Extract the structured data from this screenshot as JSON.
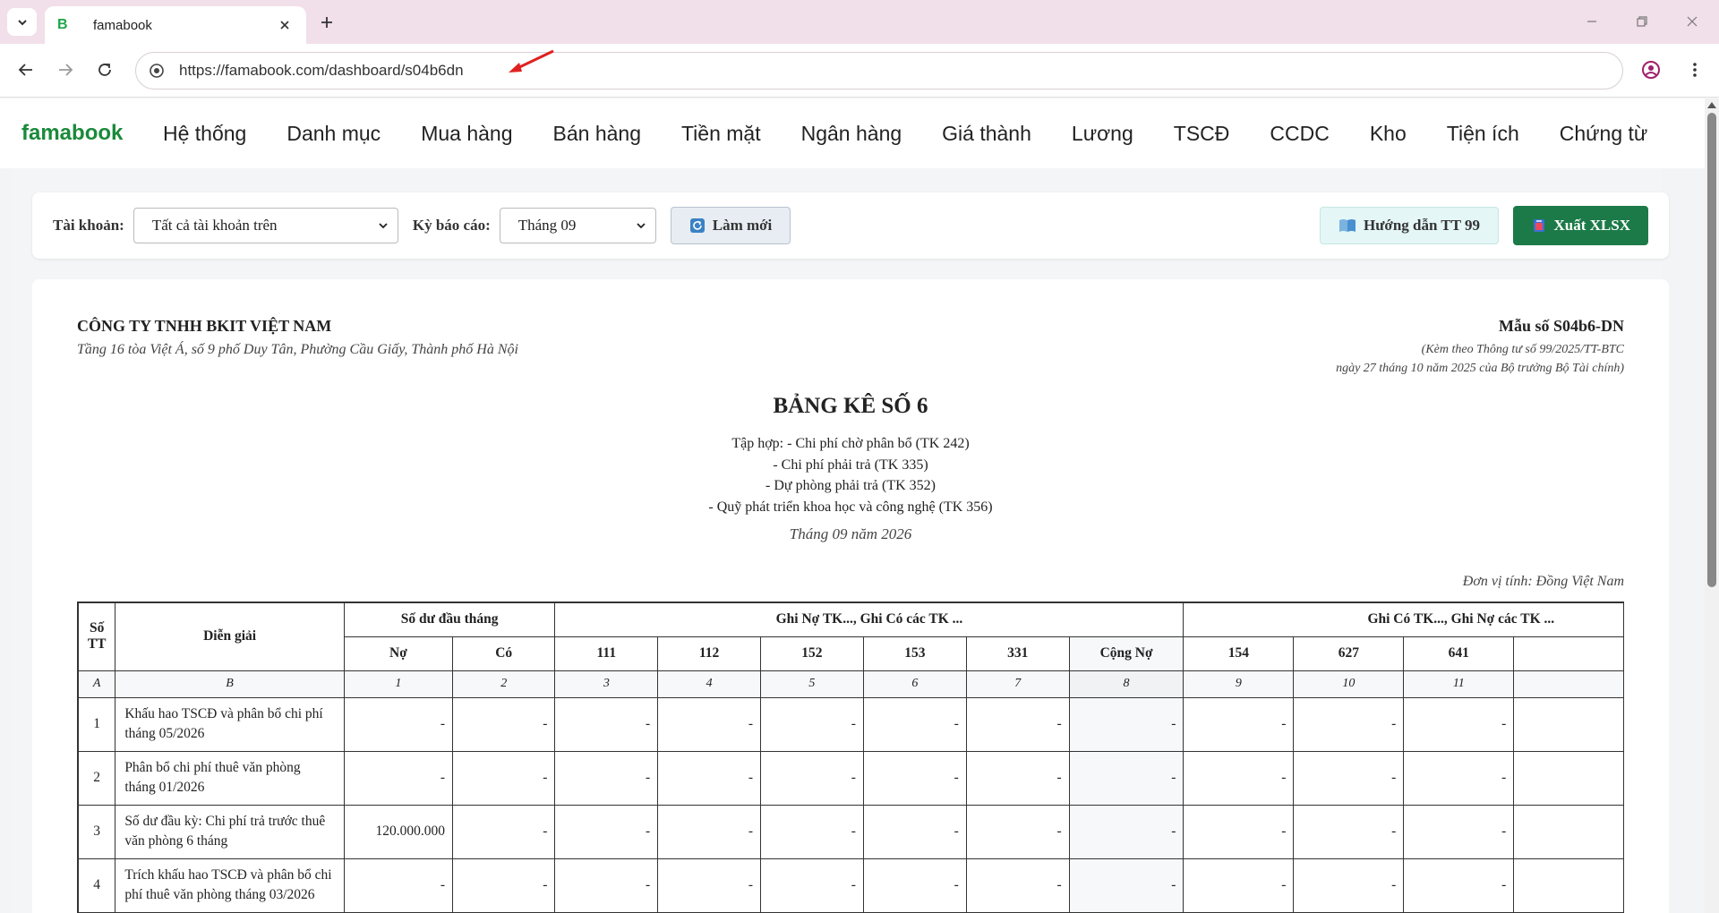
{
  "browser": {
    "tab_favicon": "B",
    "tab_title": "famabook",
    "url": "https://famabook.com/dashboard/s04b6dn"
  },
  "app": {
    "brand": "famabook",
    "menu": [
      "Hệ thống",
      "Danh mục",
      "Mua hàng",
      "Bán hàng",
      "Tiền mặt",
      "Ngân hàng",
      "Giá thành",
      "Lương",
      "TSCĐ",
      "CCDC",
      "Kho",
      "Tiện ích",
      "Chứng từ"
    ]
  },
  "filters": {
    "account_label": "Tài khoản:",
    "account_value": "Tất cả tài khoản trên",
    "period_label": "Kỳ báo cáo:",
    "period_value": "Tháng 09",
    "refresh_label": "Làm mới",
    "guide_label": "Hướng dẫn TT 99",
    "export_label": "Xuất XLSX"
  },
  "report": {
    "company": "CÔNG TY TNHH BKIT VIỆT NAM",
    "address": "Tầng 16 tòa Việt Á, số 9 phố Duy Tân, Phường Cầu Giấy, Thành phố Hà Nội",
    "form_code": "Mẫu số S04b6-DN",
    "form_note_1": "(Kèm theo Thông tư số 99/2025/TT-BTC",
    "form_note_2": "ngày 27 tháng 10 năm 2025 của Bộ trưởng Bộ Tài chính)",
    "title": "BẢNG KÊ SỐ 6",
    "lines": [
      "Tập hợp: - Chi phí chờ phân bổ (TK 242)",
      "- Chi phí phải trả (TK 335)",
      "- Dự phòng phải trả (TK 352)",
      "- Quỹ phát triển khoa học và công nghệ (TK 356)"
    ],
    "period": "Tháng 09 năm 2026",
    "unit": "Đơn vị tính: Đồng Việt Nam"
  },
  "table": {
    "h_stt": "Số TT",
    "h_desc": "Diễn giải",
    "h_opening": "Số dư đầu tháng",
    "h_debit_group": "Ghi Nợ TK..., Ghi Có các TK ...",
    "h_credit_group": "Ghi Có TK..., Ghi Nợ các TK ...",
    "h_no": "Nợ",
    "h_co": "Có",
    "h_111": "111",
    "h_112": "112",
    "h_152": "152",
    "h_153": "153",
    "h_331": "331",
    "h_cong_no": "Cộng Nợ",
    "h_154": "154",
    "h_627": "627",
    "h_641": "641",
    "idx": [
      "A",
      "B",
      "1",
      "2",
      "3",
      "4",
      "5",
      "6",
      "7",
      "8",
      "9",
      "10",
      "11",
      ""
    ],
    "rows": [
      {
        "stt": "1",
        "desc": "Khấu hao TSCĐ và phân bổ chi phí tháng 05/2026",
        "vals": [
          "-",
          "-",
          "-",
          "-",
          "-",
          "-",
          "-",
          "-",
          "-",
          "-",
          "-",
          ""
        ]
      },
      {
        "stt": "2",
        "desc": "Phân bổ chi phí thuê văn phòng tháng 01/2026",
        "vals": [
          "-",
          "-",
          "-",
          "-",
          "-",
          "-",
          "-",
          "-",
          "-",
          "-",
          "-",
          ""
        ]
      },
      {
        "stt": "3",
        "desc": "Số dư đầu kỳ: Chi phí trả trước thuê văn phòng 6 tháng",
        "vals": [
          "120.000.000",
          "-",
          "-",
          "-",
          "-",
          "-",
          "-",
          "-",
          "-",
          "-",
          "-",
          ""
        ]
      },
      {
        "stt": "4",
        "desc": "Trích khấu hao TSCĐ và phân bổ chi phí thuê văn phòng tháng 03/2026",
        "vals": [
          "-",
          "-",
          "-",
          "-",
          "-",
          "-",
          "-",
          "-",
          "-",
          "-",
          "-",
          ""
        ]
      }
    ]
  },
  "colors": {
    "brand": "#1a8a3a",
    "export_button": "#1c7a48",
    "tabbar": "#f1dfe9"
  }
}
